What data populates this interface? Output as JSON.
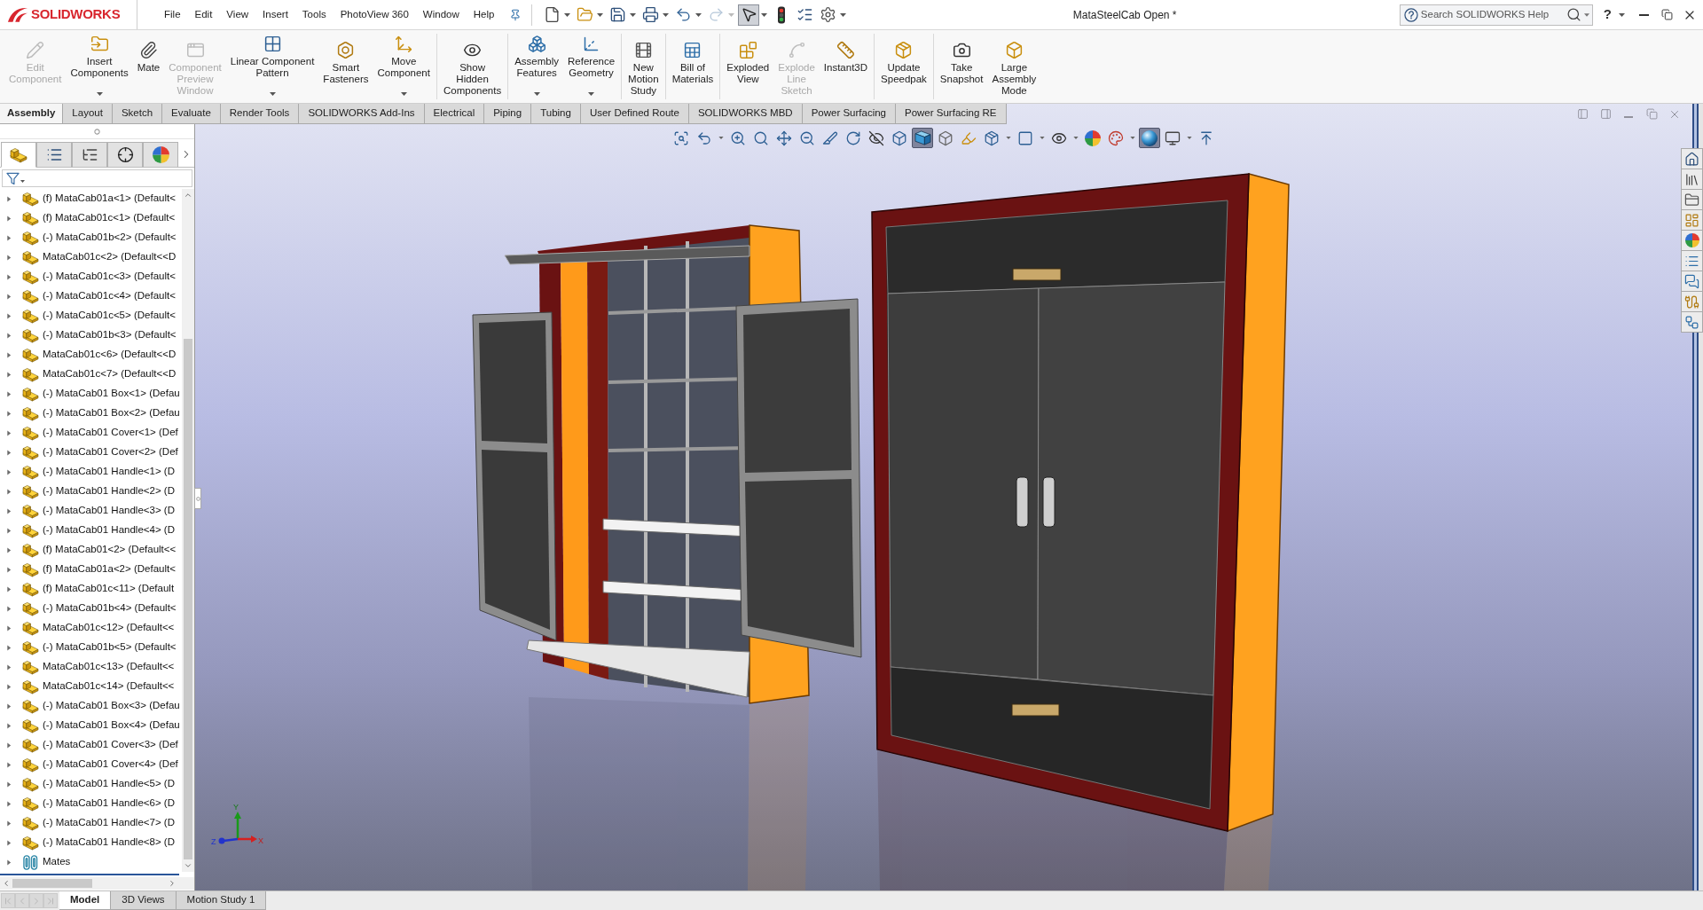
{
  "app": {
    "logo": "SOLIDWORKS"
  },
  "menu": [
    "File",
    "Edit",
    "View",
    "Insert",
    "Tools",
    "PhotoView 360",
    "Window",
    "Help"
  ],
  "quick_access": [
    {
      "dropdown": true,
      "disabled": false,
      "selected": false
    },
    {
      "dropdown": true,
      "disabled": false,
      "selected": false
    },
    {
      "dropdown": true,
      "disabled": false,
      "selected": false
    },
    {
      "dropdown": true,
      "disabled": false,
      "selected": false
    },
    {
      "dropdown": true,
      "disabled": false,
      "selected": false
    },
    {
      "dropdown": true,
      "disabled": true,
      "selected": false
    },
    {
      "dropdown": true,
      "disabled": false,
      "selected": true
    },
    {
      "dropdown": false,
      "disabled": false,
      "selected": false
    },
    {
      "dropdown": false,
      "disabled": false,
      "selected": false
    },
    {
      "dropdown": true,
      "disabled": false,
      "selected": false
    }
  ],
  "window": {
    "title": "MataSteelCab Open *"
  },
  "help_search": {
    "placeholder": "Search SOLIDWORKS Help"
  },
  "help_menu": {
    "label": "?"
  },
  "ribbon": {
    "groups": [
      {
        "buttons": [
          {
            "label": "Edit\nComponent",
            "disabled": true,
            "dropdown": false
          },
          {
            "label": "Insert\nComponents",
            "disabled": false,
            "dropdown": true
          },
          {
            "label": "Mate",
            "disabled": false,
            "dropdown": false
          },
          {
            "label": "Component\nPreview\nWindow",
            "disabled": true,
            "dropdown": false
          },
          {
            "label": "Linear Component\nPattern",
            "disabled": false,
            "dropdown": true
          },
          {
            "label": "Smart\nFasteners",
            "disabled": false,
            "dropdown": false
          },
          {
            "label": "Move\nComponent",
            "disabled": false,
            "dropdown": true
          }
        ]
      },
      {
        "buttons": [
          {
            "label": "Show\nHidden\nComponents",
            "disabled": false,
            "dropdown": false
          }
        ]
      },
      {
        "buttons": [
          {
            "label": "Assembly\nFeatures",
            "disabled": false,
            "dropdown": true
          },
          {
            "label": "Reference\nGeometry",
            "disabled": false,
            "dropdown": true
          }
        ]
      },
      {
        "buttons": [
          {
            "label": "New\nMotion\nStudy",
            "disabled": false,
            "dropdown": false
          }
        ]
      },
      {
        "buttons": [
          {
            "label": "Bill of\nMaterials",
            "disabled": false,
            "dropdown": false
          }
        ]
      },
      {
        "buttons": [
          {
            "label": "Exploded\nView",
            "disabled": false,
            "dropdown": false
          },
          {
            "label": "Explode\nLine\nSketch",
            "disabled": true,
            "dropdown": false
          },
          {
            "label": "Instant3D",
            "disabled": false,
            "dropdown": false
          }
        ]
      },
      {
        "buttons": [
          {
            "label": "Update\nSpeedpak",
            "disabled": false,
            "dropdown": false
          }
        ]
      },
      {
        "buttons": [
          {
            "label": "Take\nSnapshot",
            "disabled": false,
            "dropdown": false
          },
          {
            "label": "Large\nAssembly\nMode",
            "disabled": false,
            "dropdown": false
          }
        ]
      }
    ]
  },
  "command_tabs": [
    {
      "label": "Assembly",
      "selected": true
    },
    {
      "label": "Layout",
      "selected": false
    },
    {
      "label": "Sketch",
      "selected": false
    },
    {
      "label": "Evaluate",
      "selected": false
    },
    {
      "label": "Render Tools",
      "selected": false
    },
    {
      "label": "SOLIDWORKS Add-Ins",
      "selected": false
    },
    {
      "label": "Electrical",
      "selected": false
    },
    {
      "label": "Piping",
      "selected": false
    },
    {
      "label": "Tubing",
      "selected": false
    },
    {
      "label": "User Defined Route",
      "selected": false
    },
    {
      "label": "SOLIDWORKS MBD",
      "selected": false
    },
    {
      "label": "Power Surfacing",
      "selected": false
    },
    {
      "label": "Power Surfacing RE",
      "selected": false
    }
  ],
  "feature_tree": {
    "tabs": [
      {
        "selected": true
      },
      {
        "selected": false
      },
      {
        "selected": false
      },
      {
        "selected": false
      },
      {
        "selected": false
      }
    ],
    "items": [
      {
        "label": "(f) MataCab01a<1> (Default<",
        "kind": "part",
        "expanded": false
      },
      {
        "label": "(f) MataCab01c<1> (Default<",
        "kind": "part",
        "expanded": false
      },
      {
        "label": "(-) MataCab01b<2> (Default<",
        "kind": "part",
        "expanded": false
      },
      {
        "label": "MataCab01c<2> (Default<<D",
        "kind": "part",
        "expanded": false
      },
      {
        "label": "(-) MataCab01c<3> (Default<",
        "kind": "part",
        "expanded": false
      },
      {
        "label": "(-) MataCab01c<4> (Default<",
        "kind": "part",
        "expanded": false
      },
      {
        "label": "(-) MataCab01c<5> (Default<",
        "kind": "part",
        "expanded": false
      },
      {
        "label": "(-) MataCab01b<3> (Default<",
        "kind": "part",
        "expanded": false
      },
      {
        "label": "MataCab01c<6> (Default<<D",
        "kind": "part",
        "expanded": false
      },
      {
        "label": "MataCab01c<7> (Default<<D",
        "kind": "part",
        "expanded": false
      },
      {
        "label": "(-) MataCab01 Box<1> (Defau",
        "kind": "part",
        "expanded": false
      },
      {
        "label": "(-) MataCab01 Box<2> (Defau",
        "kind": "part",
        "expanded": false
      },
      {
        "label": "(-) MataCab01 Cover<1> (Def",
        "kind": "part",
        "expanded": false
      },
      {
        "label": "(-) MataCab01 Cover<2> (Def",
        "kind": "part",
        "expanded": false
      },
      {
        "label": "(-) MataCab01 Handle<1> (D",
        "kind": "part",
        "expanded": false
      },
      {
        "label": "(-) MataCab01 Handle<2> (D",
        "kind": "part",
        "expanded": false
      },
      {
        "label": "(-) MataCab01 Handle<3> (D",
        "kind": "part",
        "expanded": false
      },
      {
        "label": "(-) MataCab01 Handle<4> (D",
        "kind": "part",
        "expanded": false
      },
      {
        "label": "(f) MataCab01<2> (Default<<",
        "kind": "part",
        "expanded": false
      },
      {
        "label": "(f) MataCab01a<2> (Default<",
        "kind": "part",
        "expanded": false
      },
      {
        "label": "(f) MataCab01c<11> (Default",
        "kind": "part",
        "expanded": false
      },
      {
        "label": "(-) MataCab01b<4> (Default<",
        "kind": "part",
        "expanded": false
      },
      {
        "label": "MataCab01c<12> (Default<<",
        "kind": "part",
        "expanded": false
      },
      {
        "label": "(-) MataCab01b<5> (Default<",
        "kind": "part",
        "expanded": false
      },
      {
        "label": "MataCab01c<13> (Default<<",
        "kind": "part",
        "expanded": false
      },
      {
        "label": "MataCab01c<14> (Default<<",
        "kind": "part",
        "expanded": false
      },
      {
        "label": "(-) MataCab01 Box<3> (Defau",
        "kind": "part",
        "expanded": false
      },
      {
        "label": "(-) MataCab01 Box<4> (Defau",
        "kind": "part",
        "expanded": false
      },
      {
        "label": "(-) MataCab01 Cover<3> (Def",
        "kind": "part",
        "expanded": false
      },
      {
        "label": "(-) MataCab01 Cover<4> (Def",
        "kind": "part",
        "expanded": false
      },
      {
        "label": "(-) MataCab01 Handle<5> (D",
        "kind": "part",
        "expanded": false
      },
      {
        "label": "(-) MataCab01 Handle<6> (D",
        "kind": "part",
        "expanded": false
      },
      {
        "label": "(-) MataCab01 Handle<7> (D",
        "kind": "part",
        "expanded": false
      },
      {
        "label": "(-) MataCab01 Handle<8> (D",
        "kind": "part",
        "expanded": false
      },
      {
        "label": "Mates",
        "kind": "mates",
        "expanded": false
      }
    ]
  },
  "view_toolbar": [
    {
      "dropdown": false,
      "selected": false
    },
    {
      "dropdown": true,
      "selected": false
    },
    {
      "dropdown": false,
      "selected": false
    },
    {
      "dropdown": false,
      "selected": false
    },
    {
      "dropdown": false,
      "selected": false
    },
    {
      "dropdown": false,
      "selected": false
    },
    {
      "dropdown": false,
      "selected": false
    },
    {
      "dropdown": false,
      "selected": false
    },
    {
      "dropdown": false,
      "selected": false
    },
    {
      "dropdown": false,
      "selected": false
    },
    {
      "dropdown": false,
      "selected": true
    },
    {
      "dropdown": false,
      "selected": false
    },
    {
      "dropdown": false,
      "selected": false
    },
    {
      "dropdown": true,
      "selected": false
    },
    {
      "dropdown": true,
      "selected": false
    },
    {
      "dropdown": true,
      "selected": false
    },
    {
      "dropdown": false,
      "selected": false
    },
    {
      "dropdown": true,
      "selected": false
    },
    {
      "dropdown": false,
      "selected": true
    },
    {
      "dropdown": true,
      "selected": false
    },
    {
      "dropdown": false,
      "selected": false
    }
  ],
  "triad": {
    "x": "X",
    "y": "Y",
    "z": "Z"
  },
  "bottom_bar": {
    "scroll_buttons": [
      {
        "disabled": true
      },
      {
        "disabled": true
      },
      {
        "disabled": true
      },
      {
        "disabled": true
      }
    ],
    "tabs": [
      {
        "label": "Model",
        "selected": true
      },
      {
        "label": "3D Views",
        "selected": false
      },
      {
        "label": "Motion Study 1",
        "selected": false
      }
    ]
  }
}
